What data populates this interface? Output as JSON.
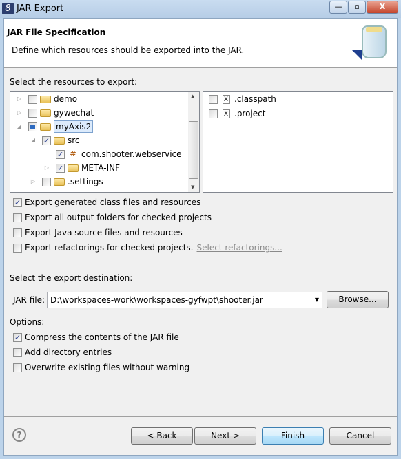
{
  "window": {
    "title": "JAR Export",
    "minimize": "—",
    "maximize": "▫",
    "close": "X"
  },
  "header": {
    "title": "JAR File Specification",
    "description": "Define which resources should be exported into the JAR."
  },
  "resources": {
    "label": "Select the resources to export:",
    "tree": [
      {
        "label": "demo",
        "checked": "off",
        "expander": "▷"
      },
      {
        "label": "gywechat",
        "checked": "off",
        "expander": "▷"
      },
      {
        "label": "myAxis2",
        "checked": "partial",
        "expander": "◢"
      },
      {
        "label": "src",
        "checked": "on",
        "expander": "◢"
      },
      {
        "label": "com.shooter.webservice",
        "checked": "on",
        "expander": ""
      },
      {
        "label": "META-INF",
        "checked": "on",
        "expander": "▷"
      },
      {
        "label": ".settings",
        "checked": "off",
        "expander": "▷"
      }
    ],
    "files": [
      {
        "label": ".classpath",
        "checked": "off"
      },
      {
        "label": ".project",
        "checked": "off"
      }
    ]
  },
  "options_top": [
    {
      "label": "Export generated class files and resources",
      "checked": true
    },
    {
      "label": "Export all output folders for checked projects",
      "checked": false
    },
    {
      "label": "Export Java source files and resources",
      "checked": false
    },
    {
      "label": "Export refactorings for checked projects.",
      "checked": false,
      "link": "Select refactorings..."
    }
  ],
  "destination": {
    "label": "Select the export destination:",
    "jar_label": "JAR file:",
    "jar_value": "D:\\workspaces-work\\workspaces-gyfwpt\\shooter.jar",
    "browse": "Browse..."
  },
  "options": {
    "label": "Options:",
    "items": [
      {
        "label": "Compress the contents of the JAR file",
        "checked": true
      },
      {
        "label": "Add directory entries",
        "checked": false
      },
      {
        "label": "Overwrite existing files without warning",
        "checked": false
      }
    ]
  },
  "footer": {
    "help": "?",
    "back": "< Back",
    "next": "Next >",
    "finish": "Finish",
    "cancel": "Cancel"
  }
}
